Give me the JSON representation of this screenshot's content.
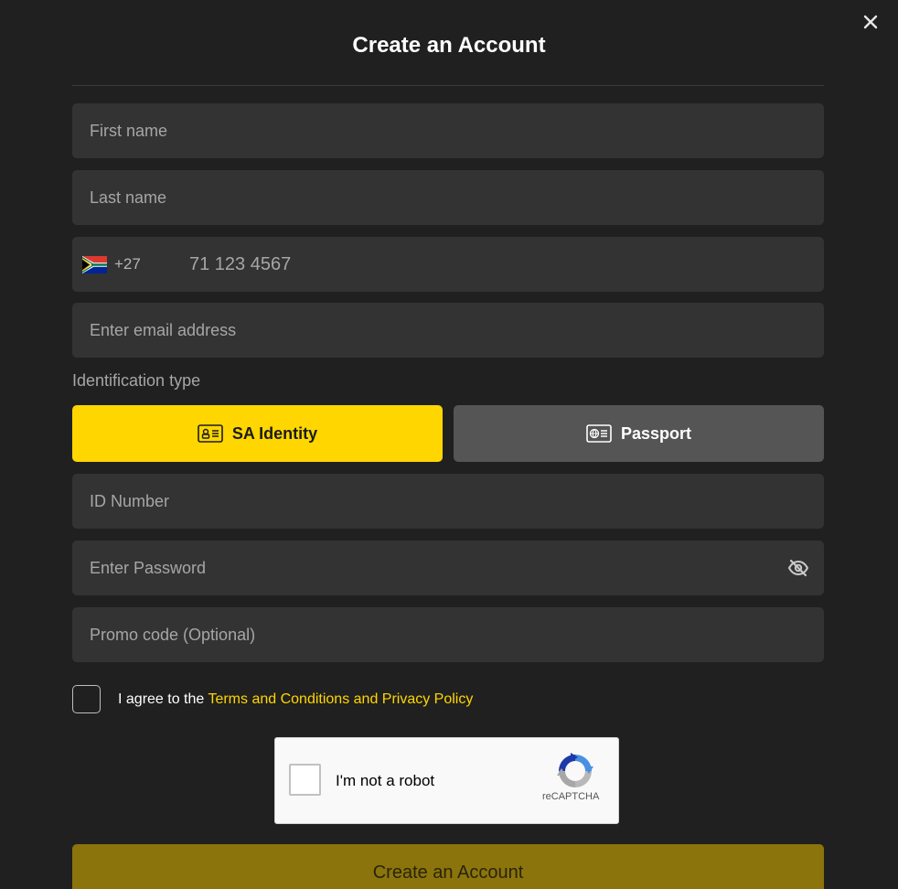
{
  "modal": {
    "title": "Create an Account",
    "close_icon": "close-icon"
  },
  "form": {
    "first_name": {
      "placeholder": "First name",
      "value": ""
    },
    "last_name": {
      "placeholder": "Last name",
      "value": ""
    },
    "phone": {
      "country_flag_icon": "south-africa-flag-icon",
      "country_code": "+27",
      "placeholder": "71 123 4567",
      "value": ""
    },
    "email": {
      "placeholder": "Enter email address",
      "value": ""
    },
    "id_type": {
      "label": "Identification type",
      "options": [
        {
          "label": "SA Identity",
          "icon": "id-card-icon",
          "selected": true
        },
        {
          "label": "Passport",
          "icon": "passport-icon",
          "selected": false
        }
      ]
    },
    "id_number": {
      "placeholder": "ID Number",
      "value": ""
    },
    "password": {
      "placeholder": "Enter Password",
      "value": "",
      "toggle_icon": "eye-off-icon"
    },
    "promo": {
      "placeholder": "Promo code (Optional)",
      "value": ""
    },
    "agree": {
      "prefix": "I agree to the ",
      "link": "Terms and Conditions and Privacy Policy",
      "checked": false
    },
    "recaptcha": {
      "label": "I'm not a robot",
      "brand": "reCAPTCHA",
      "checked": false
    },
    "submit_label": "Create an Account"
  },
  "colors": {
    "background": "#202020",
    "field": "#333333",
    "accent": "#ffd600",
    "secondary_button": "#555555",
    "submit_disabled": "#8b740c"
  }
}
